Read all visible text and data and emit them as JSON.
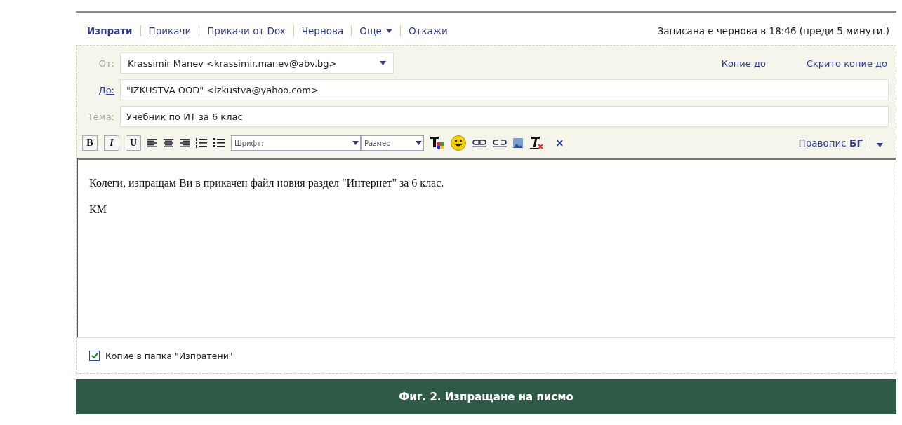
{
  "actions": [
    {
      "label": "Изпрати",
      "kind": "primary"
    },
    {
      "label": "Прикачи",
      "kind": "link"
    },
    {
      "label": "Прикачи от Dox",
      "kind": "link"
    },
    {
      "label": "Чернова",
      "kind": "link"
    },
    {
      "label": "Още",
      "kind": "menu"
    },
    {
      "label": "Откажи",
      "kind": "link"
    }
  ],
  "draft_status": "Записана е чернова в 18:46 (преди 5 минути.)",
  "from": {
    "label": "От:",
    "value": "Krassimir Manev <krassimir.manev@abv.bg>"
  },
  "cc_links": [
    "Копие до",
    "Скрито копие до"
  ],
  "to": {
    "label": "До:",
    "value": "\"IZKUSTVA OOD\" <izkustva@yahoo.com>"
  },
  "subject": {
    "label": "Тема:",
    "value": "Учебник по ИТ за 6 клас"
  },
  "toolbar": {
    "format_buttons": [
      "B",
      "I",
      "U"
    ],
    "font_select": "Шрифт:",
    "size_select": "Размер",
    "close_mark": "×",
    "spellcheck": "Правопис **БГ**"
  },
  "body": [
    "Колеги, изпращам Ви в прикачен файл новия раздел \"Интернет\" за 6 клас.",
    "КМ"
  ],
  "save_copy": {
    "label": "Копие в папка \"Изпратени\"",
    "checked": true
  },
  "caption": "Фиг. 2. Изпращане на писмо"
}
